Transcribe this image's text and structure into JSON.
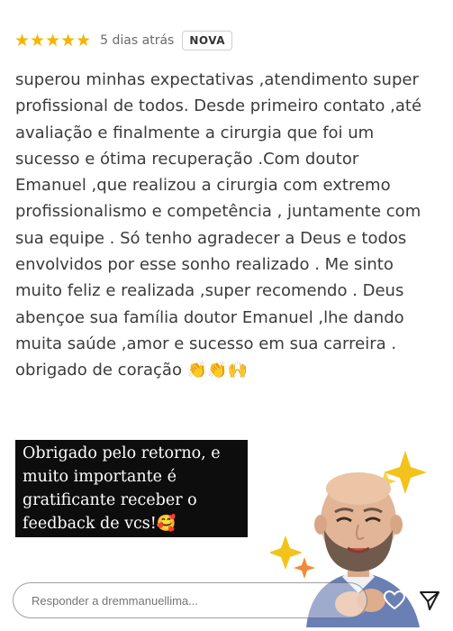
{
  "review": {
    "stars": "★★★★★",
    "rating": 5,
    "date": "5 dias atrás",
    "badge": "NOVA",
    "text": "superou minhas expectativas ,atendimento super\nprofissional de todos. Desde primeiro contato ,até\navaliação e finalmente a cirurgia que foi um\nsucesso e ótima recuperação .Com doutor\nEmanuel ,que realizou a cirurgia com extremo\nprofissionalismo e competência , juntamente com\nsua equipe . Só tenho agradecer a Deus e todos\nenvolvidos por esse sonho realizado . Me sinto\nmuito feliz e realizada ,super recomendo . Deus\nabençoe sua família doutor Emanuel ,lhe dando\nmuita saúde ,amor e sucesso em sua carreira .\nobrigado de coração 👏👏🙌"
  },
  "reply": {
    "text": "Obrigado pelo retorno, e\nmuito importante é\ngratificante receber o\nfeedback de vcs!🥰"
  },
  "bottom": {
    "placeholder": "Responder a dremmanuellima..."
  },
  "icons": {
    "star": "star-icon",
    "heart": "heart-icon",
    "send": "send-icon",
    "sparkle": "sparkle-icon",
    "avatar": "avatar-sticker"
  },
  "colors": {
    "star": "#f5b400",
    "reply_bg": "#0d0d0d",
    "sparkle": "#f3c31b"
  }
}
